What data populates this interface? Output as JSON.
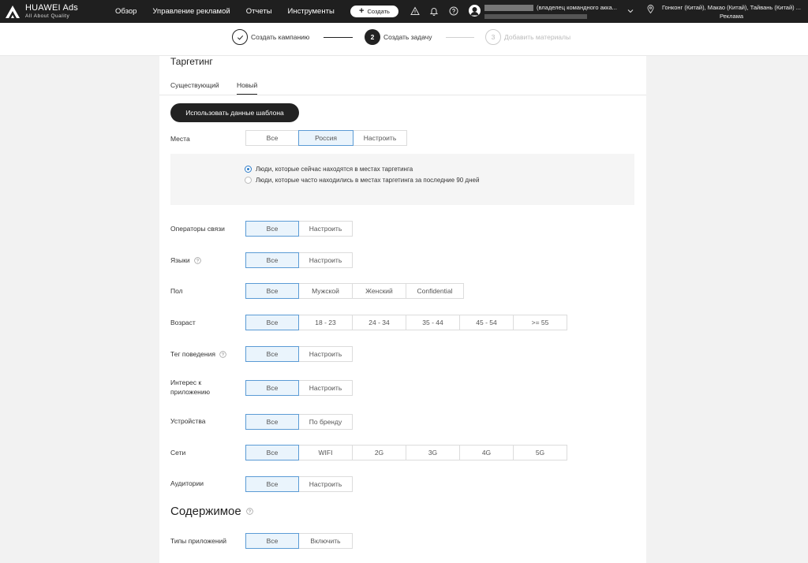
{
  "brand": {
    "title": "HUAWEI Ads",
    "subtitle": "All About Quality"
  },
  "nav": [
    {
      "label": "Обзор"
    },
    {
      "label": "Управление рекламой"
    },
    {
      "label": "Отчеты"
    },
    {
      "label": "Инструменты"
    }
  ],
  "create_button": "Создать",
  "account": {
    "owner_text": "(владелец командного акка..."
  },
  "region": {
    "line1": "Гонконг (Китай), Макао (Китай), Тайвань (Китай) ...",
    "line2": "Реклама"
  },
  "steps": [
    {
      "number": "",
      "label": "Создать кампанию"
    },
    {
      "number": "2",
      "label": "Создать задачу"
    },
    {
      "number": "3",
      "label": "Добавить материалы"
    }
  ],
  "targeting": {
    "title": "Таргетинг",
    "tabs": [
      "Существующий",
      "Новый"
    ],
    "template_button": "Использовать данные шаблона",
    "places": {
      "label": "Места",
      "options": [
        "Все",
        "Россия",
        "Настроить"
      ],
      "selected": 1
    },
    "place_modes": [
      {
        "label": "Люди, которые сейчас находятся в местах таргетинга",
        "checked": true
      },
      {
        "label": "Люди, которые часто находились в местах таргетинга за последние 90 дней",
        "checked": false
      }
    ],
    "rows": [
      {
        "label": "Операторы связи",
        "options": [
          "Все",
          "Настроить"
        ]
      },
      {
        "label": "Языки",
        "help": true,
        "options": [
          "Все",
          "Настроить"
        ]
      },
      {
        "label": "Пол",
        "options": [
          "Все",
          "Мужской",
          "Женский",
          "Confidential"
        ]
      },
      {
        "label": "Возраст",
        "options": [
          "Все",
          "18 - 23",
          "24 - 34",
          "35 - 44",
          "45 - 54",
          ">= 55"
        ]
      },
      {
        "label": "Тег поведения",
        "help": true,
        "options": [
          "Все",
          "Настроить"
        ]
      },
      {
        "label": "Интерес к приложению",
        "options": [
          "Все",
          "Настроить"
        ]
      },
      {
        "label": "Устройства",
        "options": [
          "Все",
          "По бренду"
        ]
      },
      {
        "label": "Сети",
        "options": [
          "Все",
          "WIFI",
          "2G",
          "3G",
          "4G",
          "5G"
        ]
      },
      {
        "label": "Аудитории",
        "options": [
          "Все",
          "Настроить"
        ]
      }
    ]
  },
  "content": {
    "title": "Содержимое",
    "app_types": {
      "label": "Типы приложений",
      "options": [
        "Все",
        "Включить"
      ]
    }
  }
}
